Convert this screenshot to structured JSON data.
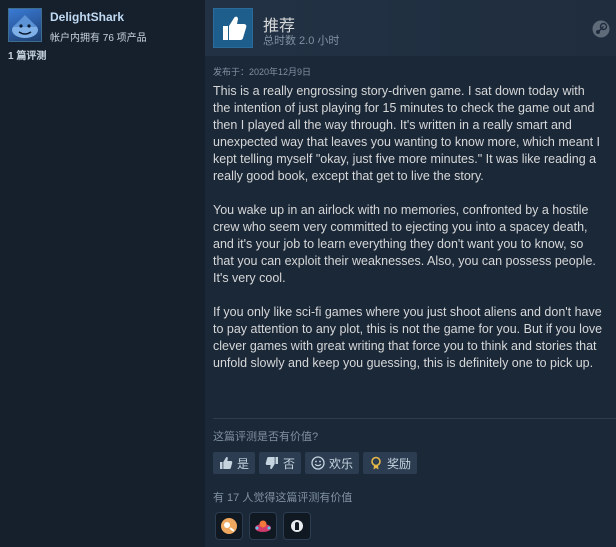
{
  "reviewer": {
    "username": "DelightShark",
    "products_owned": "帐户内拥有 76 项产品",
    "review_count": "1 篇评测"
  },
  "review": {
    "recommendation": "推荐",
    "hours": "总时数 2.0 小时",
    "posted": "发布于：2020年12月9日",
    "paragraphs": [
      "This is a really engrossing story-driven game. I sat down today with the intention of just playing for 15 minutes to check the game out and then I played all the way through. It's written in a really smart and unexpected way that leaves you wanting to know more, which meant I kept telling myself \"okay, just five more minutes.\" It was like reading a really good book, except that get to live the story.",
      "You wake up in an airlock with no memories, confronted by a hostile crew who seem very committed to ejecting you into a spacey death, and it's your job to learn everything they don't want you to know, so that you can exploit their weaknesses. Also, you can possess people. It's very cool.",
      "If you only like sci-fi games where you just shoot aliens and don't have to pay attention to any plot, this is not the game for you. But if you love clever games with great writing that force you to think and stories that unfold slowly and keep you guessing, this is definitely one to pick up."
    ]
  },
  "feedback": {
    "question": "这篇评测是否有价值?",
    "yes_label": "是",
    "no_label": "否",
    "funny_label": "欢乐",
    "award_label": "奖励",
    "helpful_count": "有 17 人觉得这篇评测有价值"
  },
  "icons": {
    "thumbs_up": "thumbs-up-icon",
    "steam_logo": "steam-logo-icon",
    "funny": "smiley-icon",
    "award": "award-icon"
  },
  "colors": {
    "background": "#1b2838",
    "accent": "#66c0f4",
    "thumb_bg": "#1d5e8d"
  }
}
